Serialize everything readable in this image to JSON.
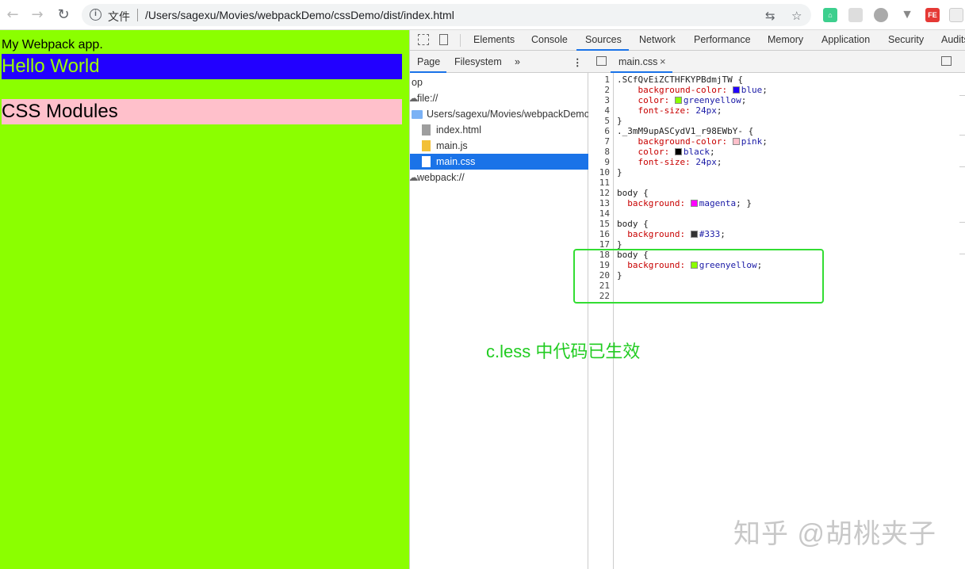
{
  "browser": {
    "back_icon": "arrow-left",
    "forward_icon": "arrow-right",
    "reload_icon": "reload",
    "info_icon": "info",
    "security_label": "文件",
    "url": "/Users/sagexu/Movies/webpackDemo/cssDemo/dist/index.html",
    "translate_icon": "translate",
    "star_icon": "star",
    "extension_fe_label": "FE"
  },
  "page": {
    "paragraph": "My Webpack app.",
    "hello": "Hello World",
    "css_modules": "CSS Modules",
    "bg_color": "#8bff00"
  },
  "devtools": {
    "tabs": [
      "Elements",
      "Console",
      "Sources",
      "Network",
      "Performance",
      "Memory",
      "Application",
      "Security",
      "Audits"
    ],
    "active_tab": "Sources",
    "navigator_tabs": [
      "Page",
      "Filesystem"
    ],
    "more_tabs_icon": "»",
    "tree": [
      {
        "label": "op",
        "type": "frame"
      },
      {
        "label": "file://",
        "type": "origin"
      },
      {
        "label": "Users/sagexu/Movies/webpackDemo/",
        "type": "folder"
      },
      {
        "label": "index.html",
        "type": "html"
      },
      {
        "label": "main.js",
        "type": "js"
      },
      {
        "label": "main.css",
        "type": "css",
        "selected": true
      },
      {
        "label": "webpack://",
        "type": "origin"
      }
    ],
    "editor_tab": "main.css",
    "close_icon": "×",
    "line_numbers": [
      "1",
      "2",
      "3",
      "4",
      "5",
      "6",
      "7",
      "8",
      "9",
      "10",
      "11",
      "12",
      "13",
      "14",
      "15",
      "16",
      "17",
      "18",
      "19",
      "20",
      "21",
      "22"
    ]
  },
  "code_lines": [
    [
      {
        "t": ".SCfQvEiZCTHFKYPBdmjTW {",
        "c": "kw"
      }
    ],
    [
      {
        "t": "    background-color: ",
        "c": "prop"
      },
      {
        "sw": "#2200ff"
      },
      {
        "t": "blue",
        "c": "val"
      },
      {
        "t": ";",
        "c": "kw"
      }
    ],
    [
      {
        "t": "    color: ",
        "c": "prop"
      },
      {
        "sw": "#8bff00"
      },
      {
        "t": "greenyellow",
        "c": "val"
      },
      {
        "t": ";",
        "c": "kw"
      }
    ],
    [
      {
        "t": "    font-size: ",
        "c": "prop"
      },
      {
        "t": "24px",
        "c": "val"
      },
      {
        "t": ";",
        "c": "kw"
      }
    ],
    [
      {
        "t": "}",
        "c": "kw"
      }
    ],
    [
      {
        "t": "._3mM9upASCydV1_r98EWbY- {",
        "c": "kw"
      }
    ],
    [
      {
        "t": "    background-color: ",
        "c": "prop"
      },
      {
        "sw": "#ffc0cb"
      },
      {
        "t": "pink",
        "c": "val"
      },
      {
        "t": ";",
        "c": "kw"
      }
    ],
    [
      {
        "t": "    color: ",
        "c": "prop"
      },
      {
        "sw": "#000000"
      },
      {
        "t": "black",
        "c": "val"
      },
      {
        "t": ";",
        "c": "kw"
      }
    ],
    [
      {
        "t": "    font-size: ",
        "c": "prop"
      },
      {
        "t": "24px",
        "c": "val"
      },
      {
        "t": ";",
        "c": "kw"
      }
    ],
    [
      {
        "t": "}",
        "c": "kw"
      }
    ],
    [],
    [
      {
        "t": "body {",
        "c": "kw"
      }
    ],
    [
      {
        "t": "  background: ",
        "c": "prop"
      },
      {
        "sw": "#ff00ff"
      },
      {
        "t": "magenta",
        "c": "val"
      },
      {
        "t": "; }",
        "c": "kw"
      }
    ],
    [],
    [
      {
        "t": "body {",
        "c": "kw"
      }
    ],
    [
      {
        "t": "  background: ",
        "c": "prop"
      },
      {
        "sw": "#333333"
      },
      {
        "t": "#333",
        "c": "val"
      },
      {
        "t": ";",
        "c": "kw"
      }
    ],
    [
      {
        "t": "}",
        "c": "kw"
      }
    ],
    [
      {
        "t": "body {",
        "c": "kw"
      }
    ],
    [
      {
        "t": "  background: ",
        "c": "prop"
      },
      {
        "sw": "#8bff00"
      },
      {
        "t": "greenyellow",
        "c": "val"
      },
      {
        "t": ";",
        "c": "kw"
      }
    ],
    [
      {
        "t": "}",
        "c": "kw"
      }
    ],
    [],
    []
  ],
  "annotation": "c.less 中代码已生效",
  "watermark": "知乎 @胡桃夹子"
}
